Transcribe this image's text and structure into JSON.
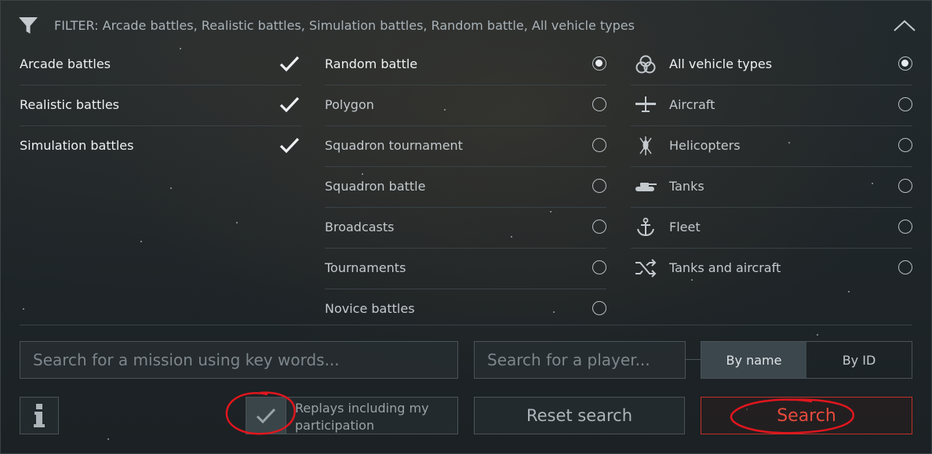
{
  "header": {
    "filter_text": "FILTER: Arcade battles, Realistic battles, Simulation battles, Random battle, All vehicle types"
  },
  "difficulty": [
    {
      "label": "Arcade battles",
      "checked": true
    },
    {
      "label": "Realistic battles",
      "checked": true
    },
    {
      "label": "Simulation battles",
      "checked": true
    }
  ],
  "modes": [
    {
      "label": "Random battle",
      "selected": true
    },
    {
      "label": "Polygon",
      "selected": false
    },
    {
      "label": "Squadron tournament",
      "selected": false
    },
    {
      "label": "Squadron battle",
      "selected": false
    },
    {
      "label": "Broadcasts",
      "selected": false
    },
    {
      "label": "Tournaments",
      "selected": false
    },
    {
      "label": "Novice battles",
      "selected": false
    }
  ],
  "vehicles": [
    {
      "label": "All vehicle types",
      "icon": "all-vehicles-icon",
      "selected": true
    },
    {
      "label": "Aircraft",
      "icon": "aircraft-icon",
      "selected": false
    },
    {
      "label": "Helicopters",
      "icon": "helicopter-icon",
      "selected": false
    },
    {
      "label": "Tanks",
      "icon": "tank-icon",
      "selected": false
    },
    {
      "label": "Fleet",
      "icon": "anchor-icon",
      "selected": false
    },
    {
      "label": "Tanks and aircraft",
      "icon": "shuffle-icon",
      "selected": false
    }
  ],
  "search": {
    "mission_placeholder": "Search for a mission using key words...",
    "player_placeholder": "Search for a player...",
    "by_name": "By name",
    "by_id": "By ID",
    "replays_label": "Replays including my participation",
    "reset_label": "Reset search",
    "search_label": "Search"
  },
  "colors": {
    "accent_red": "#c0302a",
    "annotation_red": "#e0161e"
  }
}
